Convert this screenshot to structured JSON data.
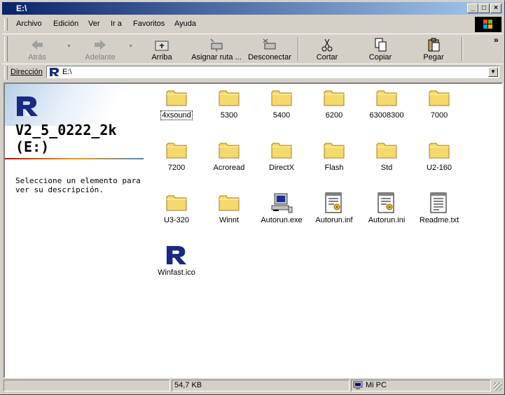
{
  "window": {
    "title": "E:\\",
    "controls": {
      "minimize": "_",
      "maximize": "□",
      "close": "×"
    }
  },
  "menubar": {
    "items": [
      "Archivo",
      "Edición",
      "Ver",
      "Ir a",
      "Favoritos",
      "Ayuda"
    ]
  },
  "toolbar": {
    "back": "Atrás",
    "forward": "Adelante",
    "up": "Arriba",
    "map_drive": "Asignar ruta ...",
    "disconnect": "Desconectar",
    "cut": "Cortar",
    "copy": "Copiar",
    "paste": "Pegar",
    "overflow": "»"
  },
  "address": {
    "label": "Dirección",
    "value": "E:\\"
  },
  "left_pane": {
    "title_line1": "V2_5_0222_2k",
    "title_line2": "(E:)",
    "description": "Seleccione un elemento para ver su descripción."
  },
  "files": [
    {
      "name": "4xsound",
      "icon": "folder-icon"
    },
    {
      "name": "5300",
      "icon": "folder-icon"
    },
    {
      "name": "5400",
      "icon": "folder-icon"
    },
    {
      "name": "6200",
      "icon": "folder-icon"
    },
    {
      "name": "63008300",
      "icon": "folder-icon"
    },
    {
      "name": "7000",
      "icon": "folder-icon"
    },
    {
      "name": "7200",
      "icon": "folder-icon"
    },
    {
      "name": "Acroread",
      "icon": "folder-icon"
    },
    {
      "name": "DirectX",
      "icon": "folder-icon"
    },
    {
      "name": "Flash",
      "icon": "folder-icon"
    },
    {
      "name": "Std",
      "icon": "folder-icon"
    },
    {
      "name": "U2-160",
      "icon": "folder-icon"
    },
    {
      "name": "U3-320",
      "icon": "folder-icon"
    },
    {
      "name": "Winnt",
      "icon": "folder-icon"
    },
    {
      "name": "Autorun.exe",
      "icon": "computer-icon"
    },
    {
      "name": "Autorun.inf",
      "icon": "settings-file-icon"
    },
    {
      "name": "Autorun.ini",
      "icon": "settings-file-icon"
    },
    {
      "name": "Readme.txt",
      "icon": "text-file-icon"
    },
    {
      "name": "Winfast.ico",
      "icon": "winfast-logo-icon"
    }
  ],
  "statusbar": {
    "size": "54,7 KB",
    "zone": "Mi PC"
  },
  "colors": {
    "title_start": "#0a246a",
    "title_end": "#a6caf0",
    "folder": "#f6d96b",
    "logo": "#1a2a80"
  }
}
